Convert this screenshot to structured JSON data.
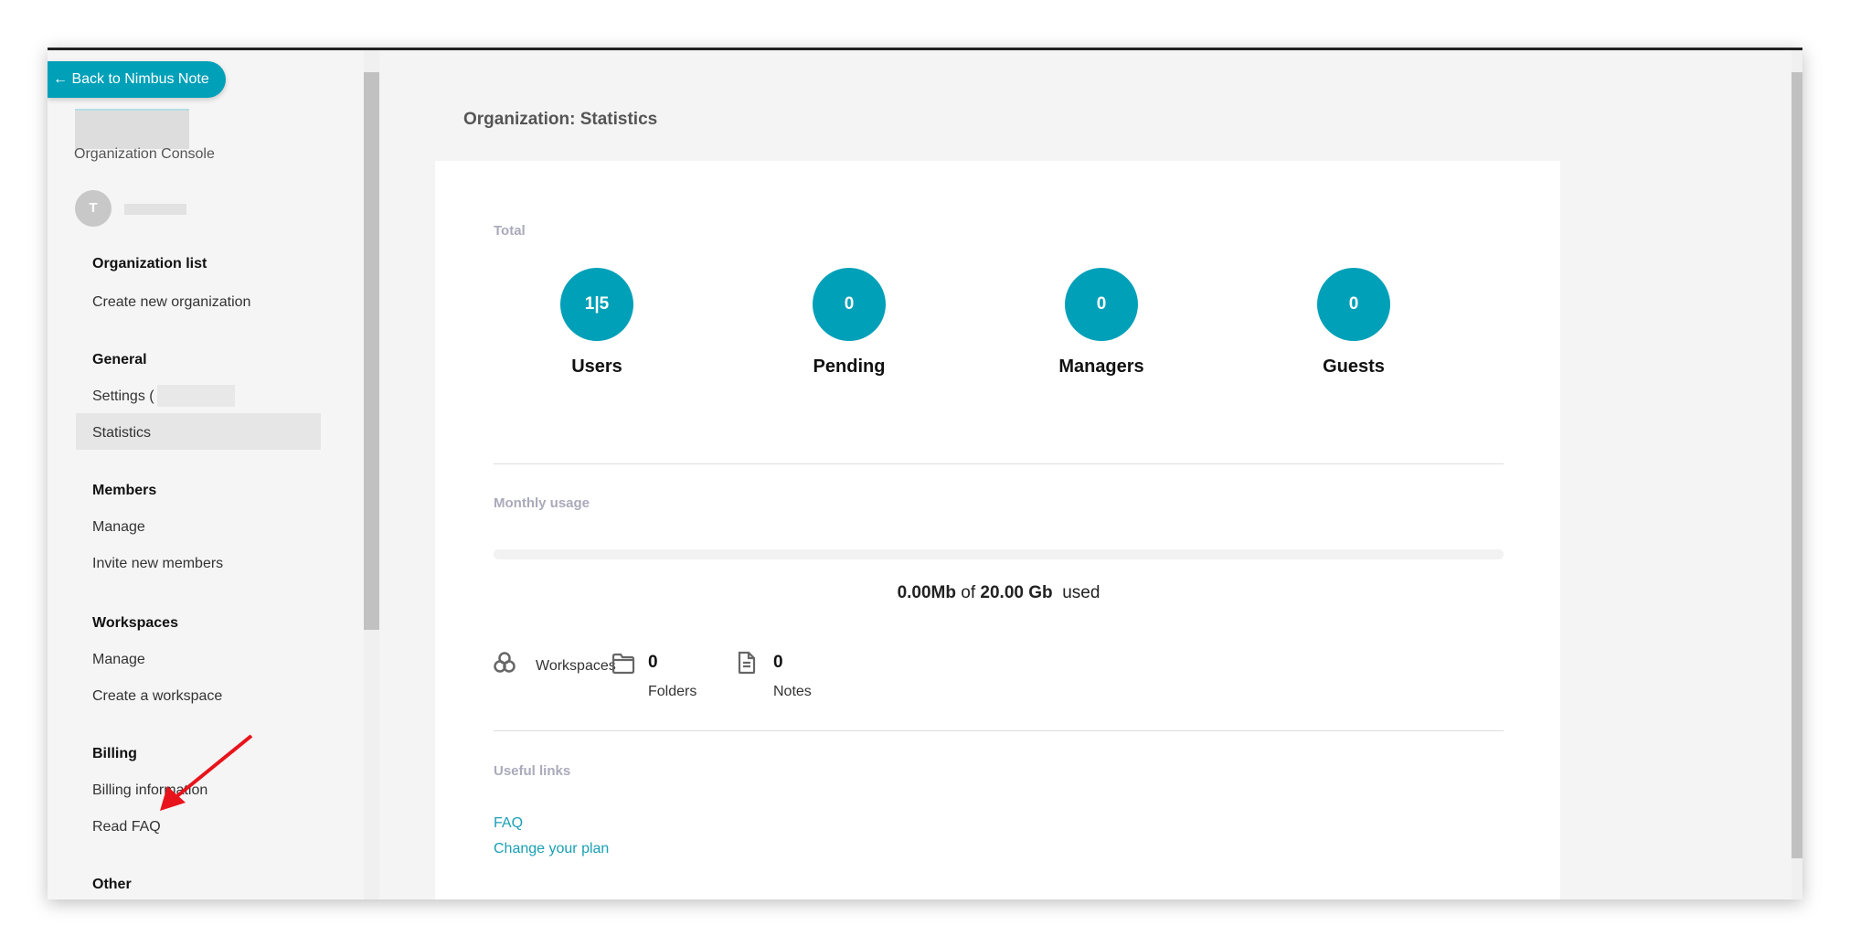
{
  "back_button": "← Back to Nimbus Note",
  "console_label": "Organization Console",
  "user_initial": "T",
  "sidebar": {
    "sections": [
      {
        "title": "Organization list",
        "items": [
          "Create new organization"
        ]
      },
      {
        "title": "General",
        "items": [
          "Settings (",
          "Statistics"
        ]
      },
      {
        "title": "Members",
        "items": [
          "Manage",
          "Invite new members"
        ]
      },
      {
        "title": "Workspaces",
        "items": [
          "Manage",
          "Create a workspace"
        ]
      },
      {
        "title": "Billing",
        "items": [
          "Billing information",
          "Read FAQ"
        ]
      },
      {
        "title": "Other",
        "items": []
      }
    ],
    "active": "Statistics"
  },
  "page_title": "Organization: Statistics",
  "total": {
    "label": "Total",
    "stats": [
      {
        "value": "1|5",
        "label": "Users"
      },
      {
        "value": "0",
        "label": "Pending"
      },
      {
        "value": "0",
        "label": "Managers"
      },
      {
        "value": "0",
        "label": "Guests"
      }
    ]
  },
  "monthly": {
    "label": "Monthly usage",
    "used": "0.00Mb",
    "of": "of",
    "total": "20.00 Gb",
    "suffix": "used",
    "progress_percent": 0
  },
  "counts": {
    "workspaces_label": "Workspaces",
    "folders_value": "0",
    "folders_label": "Folders",
    "notes_value": "0",
    "notes_label": "Notes"
  },
  "links": {
    "label": "Useful links",
    "items": [
      "FAQ",
      "Change your plan"
    ]
  },
  "colors": {
    "accent": "#00a0b8",
    "annotation_arrow": "#e8141b"
  }
}
